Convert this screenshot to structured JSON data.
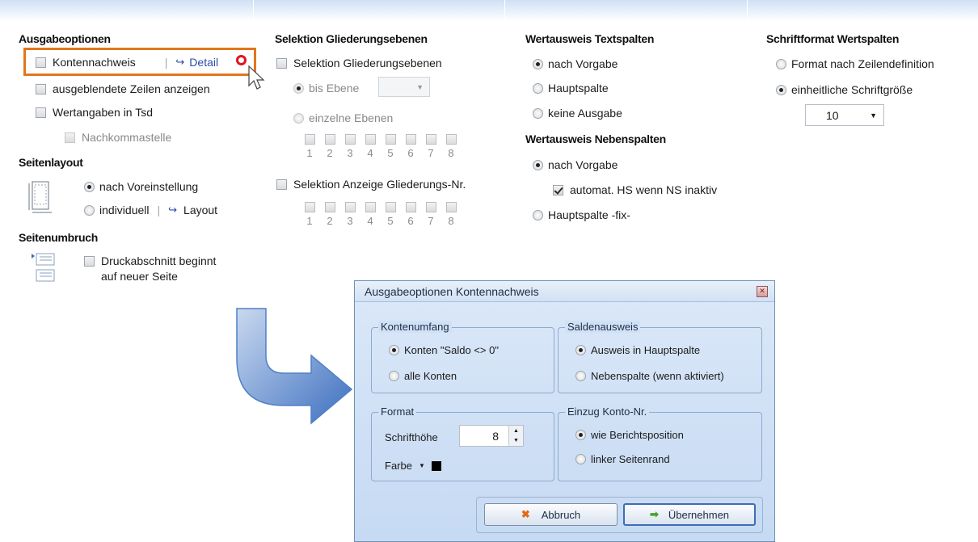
{
  "ausgabe": {
    "title": "Ausgabeoptionen",
    "kontennachweis": "Kontennachweis",
    "detail": "Detail",
    "ausgeblendete": "ausgeblendete Zeilen anzeigen",
    "wertangaben": "Wertangaben in Tsd",
    "nachkomma": "Nachkommastelle"
  },
  "seitenlayout": {
    "title": "Seitenlayout",
    "voreinstellung": "nach Voreinstellung",
    "individuell": "individuell",
    "layout_link": "Layout"
  },
  "seitenumbruch": {
    "title": "Seitenumbruch",
    "druck_line1": "Druckabschnitt beginnt",
    "druck_line2": "auf neuer Seite"
  },
  "selektion": {
    "title": "Selektion Gliederungsebenen",
    "check_label": "Selektion Gliederungsebenen",
    "bis_ebene": "bis Ebene",
    "einzelne": "einzelne Ebenen",
    "levels": [
      "1",
      "2",
      "3",
      "4",
      "5",
      "6",
      "7",
      "8"
    ],
    "anzeige_label": "Selektion Anzeige Gliederungs-Nr."
  },
  "wert_text": {
    "title": "Wertausweis Textspalten",
    "opt1": "nach Vorgabe",
    "opt2": "Hauptspalte",
    "opt3": "keine Ausgabe"
  },
  "wert_neben": {
    "title": "Wertausweis Nebenspalten",
    "opt1": "nach Vorgabe",
    "automat": "automat. HS wenn NS inaktiv",
    "opt2": "Hauptspalte -fix-"
  },
  "schrift": {
    "title": "Schriftformat Wertspalten",
    "opt1": "Format nach Zeilendefinition",
    "opt2": "einheitliche Schriftgröße",
    "size": "10"
  },
  "dialog": {
    "title": "Ausgabeoptionen  Kontennachweis",
    "kontenumfang": "Kontenumfang",
    "konten_saldo": "Konten  \"Saldo <> 0\"",
    "alle_konten": "alle Konten",
    "saldenausweis": "Saldenausweis",
    "ausweis_haupt": "Ausweis in Hauptspalte",
    "nebenspalte": "Nebenspalte (wenn  aktiviert)",
    "format": "Format",
    "schrifthoehe": "Schrifthöhe",
    "schrift_value": "8",
    "farbe": "Farbe",
    "einzug": "Einzug Konto-Nr.",
    "wie_bericht": "wie Berichtsposition",
    "linker_rand": "linker Seitenrand",
    "abbruch": "Abbruch",
    "uebernehmen": "Übernehmen"
  },
  "colors": {
    "highlight_border": "#e2761c",
    "arrow": "#4f80c7",
    "dialog_bg": "#c6daf3"
  }
}
